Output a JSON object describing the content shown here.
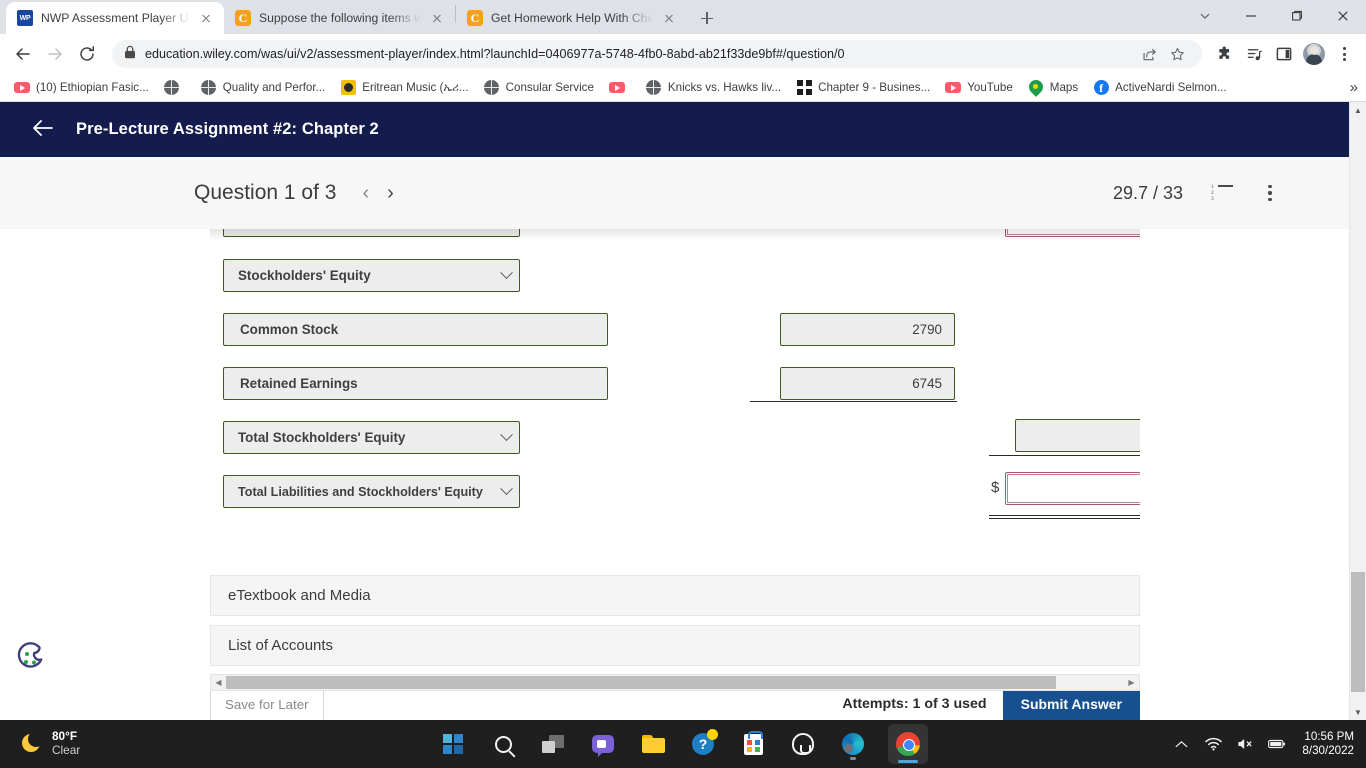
{
  "browser": {
    "tabs": [
      {
        "title": "NWP Assessment Player UI Applic",
        "favicon": "wiley-wp-icon",
        "active": true
      },
      {
        "title": "Suppose the following items wer",
        "favicon": "chegg-icon",
        "active": false
      },
      {
        "title": "Get Homework Help With Chegg",
        "favicon": "chegg-icon",
        "active": false
      }
    ],
    "new_tab_label": "+",
    "window_controls": [
      "chevron-down-icon",
      "minimize-icon",
      "maximize-icon",
      "close-icon"
    ],
    "nav": {
      "back": "back-icon",
      "forward": "forward-icon",
      "reload": "reload-icon"
    },
    "omnibox": {
      "lock": "lock-icon",
      "url_host": "education.wiley.com",
      "url_path": "/was/ui/v2/assessment-player/index.html?launchId=0406977a-5748-4fb0-8abd-ab21f33de9bf#/question/0",
      "url_full": "education.wiley.com/was/ui/v2/assessment-player/index.html?launchId=0406977a-5748-4fb0-8abd-ab21f33de9bf#/question/0",
      "actions": [
        "share-icon",
        "bookmark-star-icon"
      ]
    },
    "toolbar_icons": [
      "extensions-puzzle-icon",
      "media-playlist-icon",
      "sidepanel-icon",
      "profile-avatar",
      "chrome-menu-kebab-icon"
    ],
    "bookmarks": [
      {
        "label": "(10) Ethiopian Fasic...",
        "icon": "youtube-icon"
      },
      {
        "label": "",
        "icon": "globe-icon"
      },
      {
        "label": "Quality and Perfor...",
        "icon": "globe-icon"
      },
      {
        "label": "Eritrean Music (ኤሪ...",
        "icon": "image-icon"
      },
      {
        "label": "Consular Service",
        "icon": "globe-icon"
      },
      {
        "label": "",
        "icon": "youtube-icon"
      },
      {
        "label": "Knicks vs. Hawks liv...",
        "icon": "globe-icon"
      },
      {
        "label": "Chapter 9 - Busines...",
        "icon": "grid-icon"
      },
      {
        "label": "YouTube",
        "icon": "youtube-icon"
      },
      {
        "label": "Maps",
        "icon": "maps-pin-icon"
      },
      {
        "label": "ActiveNardi Selmon...",
        "icon": "facebook-icon"
      }
    ],
    "bookmarks_overflow": "»"
  },
  "app": {
    "header": {
      "back_icon": "back-arrow-icon",
      "title": "Pre-Lecture Assignment #2: Chapter 2"
    },
    "question_bar": {
      "title": "Question 1 of 3",
      "prev": "‹",
      "next": "›",
      "score": "29.7 / 33",
      "list_icon": "numbered-list-icon",
      "more_icon": "more-vertical-icon"
    },
    "form": {
      "rows": [
        {
          "type": "select",
          "label": "Stockholders' Equity",
          "value": ""
        },
        {
          "type": "text",
          "label": "Common Stock",
          "value": "2790"
        },
        {
          "type": "text",
          "label": "Retained Earnings",
          "value": "6745"
        },
        {
          "type": "select",
          "label": "Total Stockholders' Equity",
          "value": ""
        },
        {
          "type": "select",
          "label": "Total Liabilities and Stockholders' Equity",
          "value": ""
        }
      ],
      "currency_symbol": "$"
    },
    "hscroll": {
      "left_arrow": "◀",
      "right_arrow": "▶"
    },
    "accordions": [
      {
        "label": "eTextbook and Media"
      },
      {
        "label": "List of Accounts"
      }
    ],
    "footer": {
      "save_label": "Save for Later",
      "attempts": "Attempts: 1 of 3 used",
      "submit_label": "Submit Answer"
    },
    "cookie_icon": "cookie-consent-icon",
    "colors": {
      "header_navy": "#141b4d",
      "submit_blue": "#16508f",
      "field_border_green": "#3d5c1e",
      "error_border": "#a8586c"
    }
  },
  "taskbar": {
    "weather": {
      "temp": "80°F",
      "condition": "Clear",
      "icon": "moon-icon"
    },
    "items": [
      {
        "name": "start-button",
        "icon": "windows-logo-icon"
      },
      {
        "name": "search-button",
        "icon": "search-icon"
      },
      {
        "name": "task-view-button",
        "icon": "task-view-icon"
      },
      {
        "name": "chat-button",
        "icon": "chat-icon"
      },
      {
        "name": "file-explorer-button",
        "icon": "folder-icon"
      },
      {
        "name": "get-help-button",
        "icon": "help-circle-icon"
      },
      {
        "name": "microsoft-store-button",
        "icon": "store-icon"
      },
      {
        "name": "home-button",
        "icon": "home-outline-icon"
      },
      {
        "name": "edge-button",
        "icon": "edge-icon"
      },
      {
        "name": "chrome-button",
        "icon": "chrome-icon"
      }
    ],
    "tray": {
      "chevron": "^",
      "wifi": "wifi-icon",
      "volume": "volume-muted-icon",
      "battery": "battery-icon",
      "time": "10:56 PM",
      "date": "8/30/2022"
    }
  }
}
